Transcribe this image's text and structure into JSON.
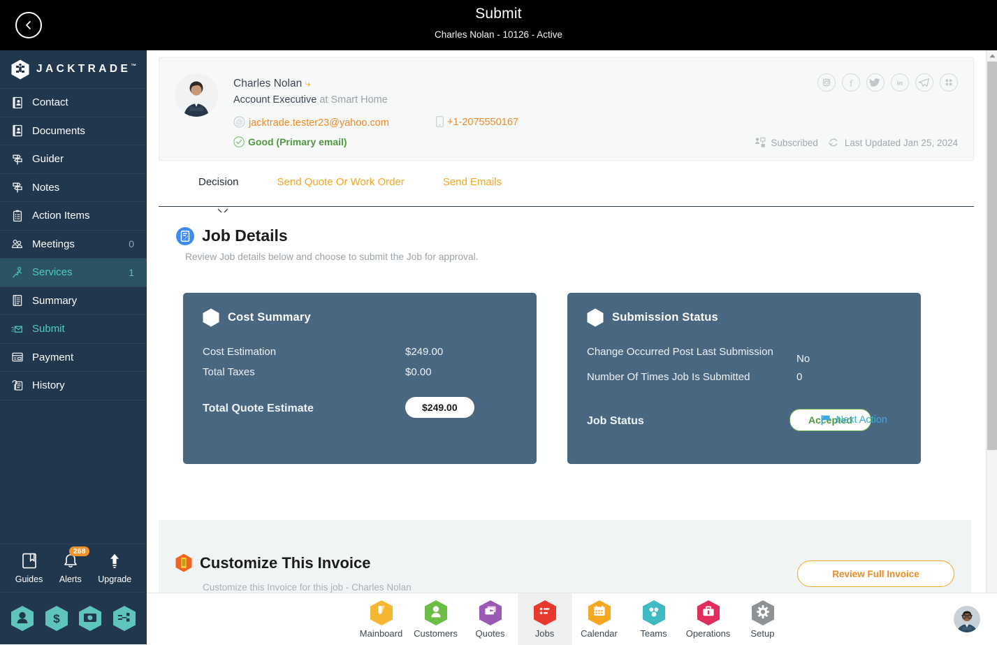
{
  "header": {
    "back_icon": "chevron-left-icon",
    "title": "Submit",
    "subtitle": "Charles Nolan - 10126 - Active"
  },
  "sidebar": {
    "brand": "JACKTRADE",
    "brand_tm": "™",
    "items": [
      {
        "label": "Contact",
        "icon": "contact-card-icon",
        "count": "",
        "state": "normal"
      },
      {
        "label": "Documents",
        "icon": "document-icon",
        "count": "",
        "state": "normal"
      },
      {
        "label": "Guider",
        "icon": "signpost-icon",
        "count": "",
        "state": "normal"
      },
      {
        "label": "Notes",
        "icon": "signpost-icon",
        "count": "",
        "state": "normal"
      },
      {
        "label": "Action Items",
        "icon": "clipboard-icon",
        "count": "",
        "state": "normal"
      },
      {
        "label": "Meetings",
        "icon": "meetings-icon",
        "count": "0",
        "state": "normal"
      },
      {
        "label": "Services",
        "icon": "services-icon",
        "count": "1",
        "state": "active"
      },
      {
        "label": "Summary",
        "icon": "book-icon",
        "count": "",
        "state": "normal"
      },
      {
        "label": "Submit",
        "icon": "send-mail-icon",
        "count": "",
        "state": "teal"
      },
      {
        "label": "Payment",
        "icon": "payment-card-icon",
        "count": "",
        "state": "normal"
      },
      {
        "label": "History",
        "icon": "history-icon",
        "count": "",
        "state": "normal"
      }
    ],
    "utilities": [
      {
        "label": "Guides",
        "icon": "book-bookmark-icon",
        "badge": ""
      },
      {
        "label": "Alerts",
        "icon": "bell-icon",
        "badge": "268"
      },
      {
        "label": "Upgrade",
        "icon": "up-arrow-icon",
        "badge": ""
      }
    ],
    "hex_shortcuts": [
      {
        "icon": "person-icon"
      },
      {
        "icon": "dollar-icon"
      },
      {
        "icon": "money-transfer-icon"
      },
      {
        "icon": "workflow-icon"
      }
    ]
  },
  "contact": {
    "avatar": "contact-avatar",
    "name": "Charles Nolan",
    "share_icon": "share-arrow-icon",
    "role": "Account Executive",
    "role_suffix": "at Smart Home",
    "email": "jacktrade.tester23@yahoo.com",
    "email_icon": "at-sign-icon",
    "phone": "+1-2075550167",
    "phone_icon": "mobile-phone-icon",
    "email_status": "Good (Primary email)",
    "email_status_icon": "check-circle-icon",
    "social": [
      {
        "icon": "instagram-icon",
        "glyph": "instagram"
      },
      {
        "icon": "facebook-icon",
        "glyph": "f"
      },
      {
        "icon": "twitter-icon",
        "glyph": "twitter"
      },
      {
        "icon": "linkedin-icon",
        "glyph": "in"
      },
      {
        "icon": "telegram-icon",
        "glyph": "telegram"
      },
      {
        "icon": "apps-grid-icon",
        "glyph": "grid"
      }
    ],
    "subscribed_label": "Subscribed",
    "subscribed_icon": "subscribe-icon",
    "last_updated_label": "Last Updated Jan 25, 2024",
    "last_updated_icon": "refresh-icon"
  },
  "tabs": [
    {
      "label": "Decision",
      "active": true
    },
    {
      "label": "Send Quote Or Work Order",
      "active": false
    },
    {
      "label": "Send Emails",
      "active": false
    }
  ],
  "job_details": {
    "icon": "job-details-icon",
    "title": "Job Details",
    "subtitle": "Review Job details below and choose to submit the Job for approval."
  },
  "cost_summary": {
    "icon": "hexagon-icon",
    "title": "Cost Summary",
    "rows": [
      {
        "key": "Cost Estimation",
        "value": "$249.00"
      },
      {
        "key": "Total Taxes",
        "value": "$0.00"
      }
    ],
    "total_label": "Total Quote Estimate",
    "total_value": "$249.00"
  },
  "submission_status": {
    "icon": "hexagon-icon",
    "title": "Submission Status",
    "rows": [
      {
        "key": "Change Occurred Post Last Submission",
        "value": "No"
      },
      {
        "key": "Number Of Times Job Is Submitted",
        "value": "0"
      }
    ],
    "job_status_label": "Job Status",
    "job_status_value": "Accepted",
    "next_action_label": "Next Action",
    "next_action_icon": "flag-icon"
  },
  "invoice": {
    "icon": "invoice-icon",
    "title": "Customize This Invoice",
    "subtitle": "Customize this Invoice for this job - Charles Nolan",
    "button_label": "Review Full Invoice"
  },
  "bottom_nav": {
    "items": [
      {
        "label": "Mainboard",
        "icon": "mainboard-icon",
        "color": "#f5b731",
        "active": false
      },
      {
        "label": "Customers",
        "icon": "customers-icon",
        "color": "#6cbe45",
        "active": false
      },
      {
        "label": "Quotes",
        "icon": "quotes-icon",
        "color": "#9b59b6",
        "active": false
      },
      {
        "label": "Jobs",
        "icon": "jobs-icon",
        "color": "#e8392f",
        "active": true
      },
      {
        "label": "Calendar",
        "icon": "calendar-icon",
        "color": "#f5a623",
        "active": false
      },
      {
        "label": "Teams",
        "icon": "teams-icon",
        "color": "#3fb9c4",
        "active": false
      },
      {
        "label": "Operations",
        "icon": "operations-icon",
        "color": "#e02d5c",
        "active": false
      },
      {
        "label": "Setup",
        "icon": "setup-icon",
        "color": "#8f9294",
        "active": false
      }
    ],
    "avatar": "user-avatar"
  },
  "scrollbar": {
    "up_icon": "scroll-up-arrow-icon",
    "down_icon": "scroll-down-arrow-icon"
  },
  "colors": {
    "topbar_bg": "#000000",
    "sidebar_bg": "#21374d",
    "sidebar_active": "#2b5362",
    "teal_accent": "#4ecdc4",
    "orange_accent": "#f5a623",
    "card_bg": "#4a6781",
    "green": "#4e9a3f",
    "link_blue": "#3ba9e0"
  }
}
